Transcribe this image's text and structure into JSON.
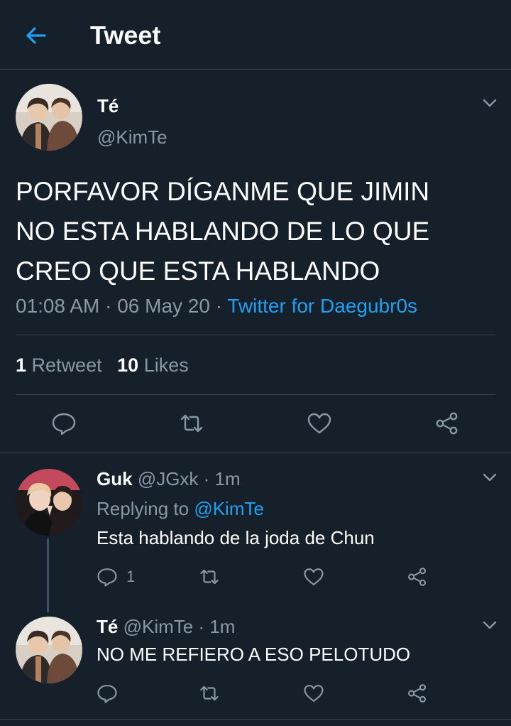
{
  "header": {
    "title": "Tweet"
  },
  "main_tweet": {
    "display_name": "Té",
    "handle": "@KimTe",
    "text_lines": [
      "PORFAVOR DÍGANME QUE JIMIN",
      "NO ESTA HABLANDO DE LO QUE",
      "CREO QUE ESTA HABLANDO"
    ],
    "time": "01:08 AM",
    "sep1": "·",
    "date": "06 May 20",
    "sep2": "·",
    "source": "Twitter for Daegubr0s",
    "retweets_count": "1",
    "retweets_label": "Retweet",
    "likes_count": "10",
    "likes_label": "Likes"
  },
  "replies": [
    {
      "display_name": "Guk",
      "handle": "@JGxk",
      "meta": "· 1m",
      "replying_label": "Replying to",
      "replying_to": "@KimTe",
      "text": "Esta hablando de la joda de Chun",
      "reply_count": "1"
    },
    {
      "display_name": "Té",
      "handle": "@KimTe",
      "meta": "· 1m",
      "text": "NO ME REFIERO A ESO PELOTUDO"
    }
  ],
  "icons": {
    "back": "arrow-left-icon",
    "chevron": "chevron-down-icon",
    "reply": "speech-bubble-icon",
    "retweet": "retweet-icon",
    "like": "heart-icon",
    "share": "share-icon"
  },
  "colors": {
    "background": "#15202b",
    "accent": "#1da1f2",
    "secondary_text": "#8899a6",
    "divider": "#38444d"
  }
}
